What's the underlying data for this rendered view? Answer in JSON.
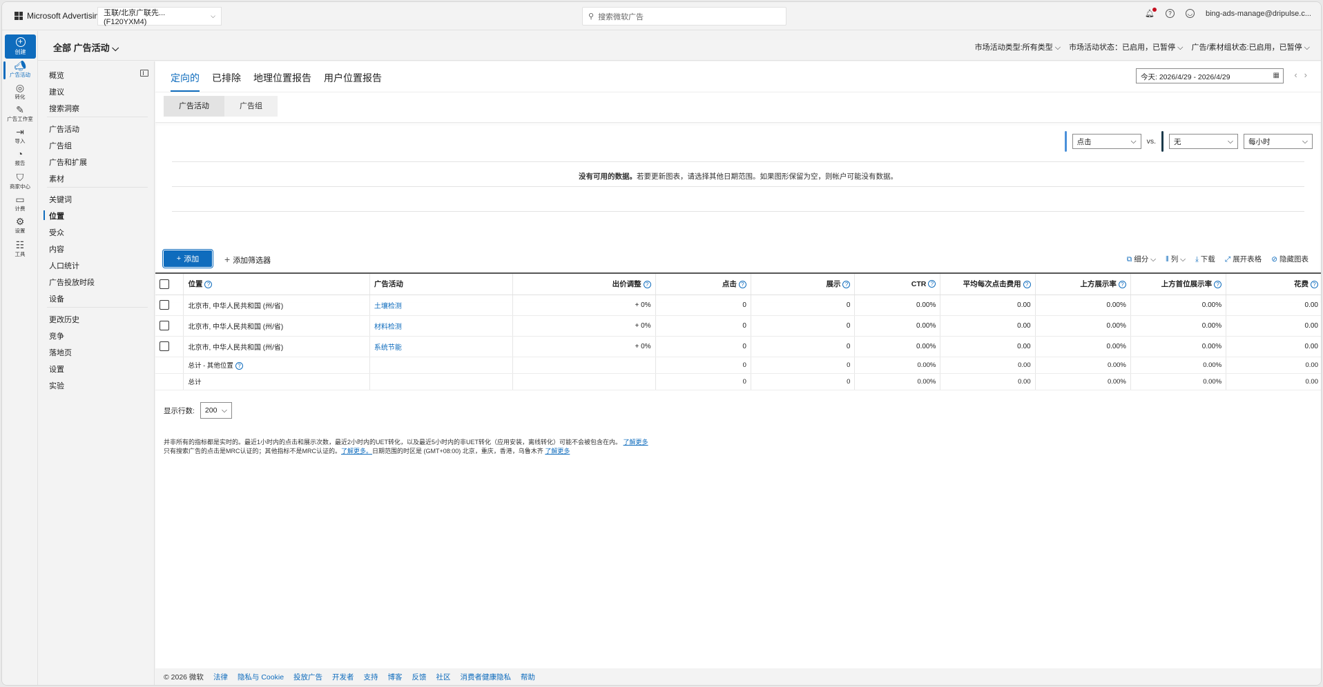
{
  "topbar": {
    "brand": "Microsoft Advertising",
    "account": "玉联/北京广联先... (F120YXM4)",
    "search_placeholder": "搜索微软广告",
    "user_email": "bing-ads-manage@dripulse.c..."
  },
  "bar2": {
    "scope": "全部 广告活动",
    "filters": [
      "市场活动类型:所有类型",
      "市场活动状态：已启用，已暂停",
      "广告/素材组状态:已启用，已暂停"
    ]
  },
  "rail": {
    "create": "创建",
    "items": [
      {
        "label": "广告活动",
        "icon": "megaphone-icon"
      },
      {
        "label": "转化",
        "icon": "target-icon"
      },
      {
        "label": "广告工作室",
        "icon": "studio-icon"
      },
      {
        "label": "导入",
        "icon": "import-icon"
      },
      {
        "label": "报告",
        "icon": "report-icon"
      },
      {
        "label": "商家中心",
        "icon": "bag-icon"
      },
      {
        "label": "计费",
        "icon": "wallet-icon"
      },
      {
        "label": "设置",
        "icon": "gear-icon"
      },
      {
        "label": "工具",
        "icon": "tools-icon"
      }
    ]
  },
  "nav": {
    "group1": [
      "概览",
      "建议",
      "搜索洞察"
    ],
    "group2": [
      "广告活动",
      "广告组",
      "广告和扩展",
      "素材"
    ],
    "group3": [
      "关键词",
      "位置",
      "受众",
      "内容",
      "人口统计",
      "广告投放时段",
      "设备"
    ],
    "group4": [
      "更改历史",
      "竞争",
      "落地页",
      "设置",
      "实验"
    ]
  },
  "tabs": [
    "定向的",
    "已排除",
    "地理位置报告",
    "用户位置报告"
  ],
  "date_range": "今天: 2026/4/29 - 2026/4/29",
  "segments": [
    "广告活动",
    "广告组"
  ],
  "chart": {
    "metric1": "点击",
    "vs": "vs.",
    "metric2": "无",
    "granularity": "每小时",
    "nodata_bold": "没有可用的数据。",
    "nodata_rest": "若要更新图表，请选择其他日期范围。如果图形保留为空，则帐户可能没有数据。",
    "metric1_color": "#4a90d9",
    "metric2_color": "#1b3a4b"
  },
  "toolbar": {
    "add": "添加",
    "add_filter": "添加筛选器",
    "segment": "细分",
    "columns": "列",
    "download": "下载",
    "expand": "展开表格",
    "hide_chart": "隐藏图表"
  },
  "table": {
    "headers": [
      "位置",
      "广告活动",
      "出价调整",
      "点击",
      "展示",
      "CTR",
      "平均每次点击费用",
      "上方展示率",
      "上方首位展示率",
      "花费"
    ],
    "rows": [
      {
        "location": "北京市, 中华人民共和国 (州/省)",
        "campaign": "土壤检测",
        "bid": "+ 0%",
        "clicks": "0",
        "impr": "0",
        "ctr": "0.00%",
        "cpc": "0.00",
        "top": "0.00%",
        "abs_top": "0.00%",
        "spend": "0.00"
      },
      {
        "location": "北京市, 中华人民共和国 (州/省)",
        "campaign": "材料检测",
        "bid": "+ 0%",
        "clicks": "0",
        "impr": "0",
        "ctr": "0.00%",
        "cpc": "0.00",
        "top": "0.00%",
        "abs_top": "0.00%",
        "spend": "0.00"
      },
      {
        "location": "北京市, 中华人民共和国 (州/省)",
        "campaign": "系统节能",
        "bid": "+ 0%",
        "clicks": "0",
        "impr": "0",
        "ctr": "0.00%",
        "cpc": "0.00",
        "top": "0.00%",
        "abs_top": "0.00%",
        "spend": "0.00"
      }
    ],
    "subtotal": {
      "label": "总计 - 其他位置",
      "clicks": "0",
      "impr": "0",
      "ctr": "0.00%",
      "cpc": "0.00",
      "top": "0.00%",
      "abs_top": "0.00%",
      "spend": "0.00"
    },
    "total": {
      "label": "总计",
      "clicks": "0",
      "impr": "0",
      "ctr": "0.00%",
      "cpc": "0.00",
      "top": "0.00%",
      "abs_top": "0.00%",
      "spend": "0.00"
    }
  },
  "rows_per_page": {
    "label": "显示行数:",
    "value": "200"
  },
  "notes": {
    "line1": "并非所有的指标都是实时的。最近1小时内的点击和展示次数，最近2小时内的UET转化，以及最近5小时内的非UET转化（应用安装，离线转化）可能不会被包含在内。",
    "line1_link": "了解更多",
    "line2a": "只有搜索广告的点击是MRC认证的；其他指标不是MRC认证的。",
    "line2_link1": "了解更多。",
    "line2b": "日期范围的时区是 (GMT+08:00) 北京，重庆，香港，乌鲁木齐",
    "line2_link2": "了解更多"
  },
  "footer": {
    "copyright": "© 2026 微软",
    "links": [
      "法律",
      "隐私与 Cookie",
      "投放广告",
      "开发者",
      "支持",
      "博客",
      "反馈",
      "社区",
      "消费者健康隐私",
      "帮助"
    ]
  }
}
